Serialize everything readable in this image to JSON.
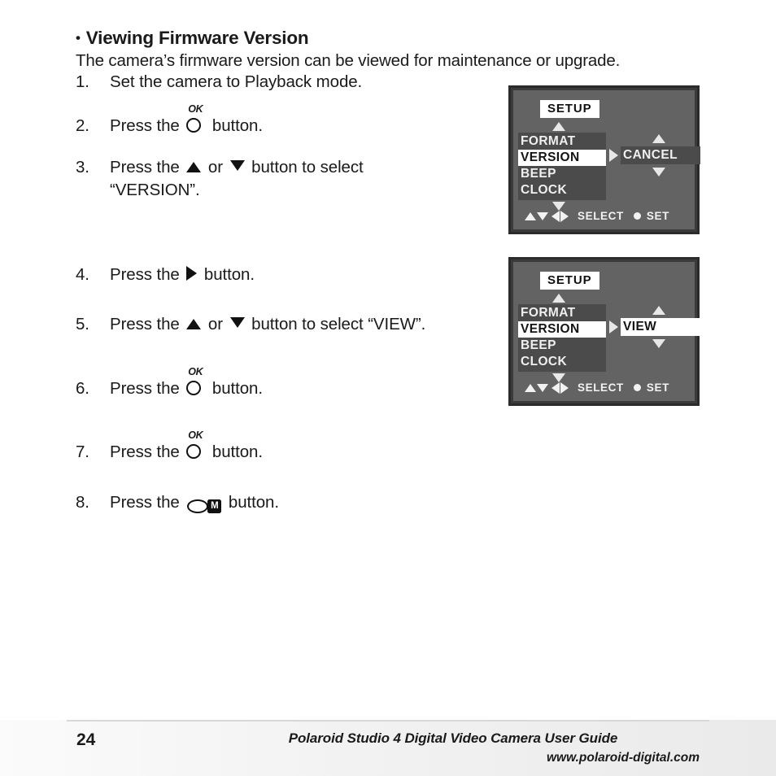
{
  "heading": {
    "bullet": "•",
    "title": "Viewing Firmware Version"
  },
  "intro": "The camera’s firmware version can be viewed for maintenance or upgrade.",
  "steps": [
    {
      "number": "1.",
      "text_before": "Set the camera to Playback mode.",
      "icon": "none",
      "text_after": "",
      "line2": ""
    },
    {
      "number": "2.",
      "text_before": "Press the",
      "icon": "ok-button-icon",
      "icon_label": "OK",
      "text_after": "button.",
      "line2": ""
    },
    {
      "number": "3.",
      "text_before": "Press the",
      "icon": "up-down-arrow-icons",
      "middle_text": "or",
      "text_after": "button to select",
      "line2": "“VERSION”."
    },
    {
      "number": "4.",
      "text_before": "Press the",
      "icon": "right-arrow-icon",
      "text_after": "button.",
      "line2": ""
    },
    {
      "number": "5.",
      "text_before": "Press the",
      "icon": "up-down-arrow-icons",
      "middle_text": "or",
      "text_after": "button to select “VIEW”.",
      "line2": ""
    },
    {
      "number": "6.",
      "text_before": "Press the",
      "icon": "ok-button-icon",
      "icon_label": "OK",
      "text_after": "button.",
      "line2": ""
    },
    {
      "number": "7.",
      "text_before": "Press the",
      "icon": "ok-button-icon",
      "icon_label": "OK",
      "text_after": "button.",
      "line2": ""
    },
    {
      "number": "8.",
      "text_before": "Press the",
      "icon": "mode-button-icon",
      "icon_label": "M",
      "text_after": "button.",
      "line2": ""
    }
  ],
  "lcd_screens": [
    {
      "title": "SETUP",
      "menu_items": [
        {
          "label": "FORMAT",
          "selected": false
        },
        {
          "label": "VERSION",
          "selected": true
        },
        {
          "label": "BEEP",
          "selected": false
        },
        {
          "label": "CLOCK",
          "selected": false
        }
      ],
      "submenu_value": "CANCEL",
      "submenu_highlighted": false,
      "hint_select": "SELECT",
      "hint_set": "SET"
    },
    {
      "title": "SETUP",
      "menu_items": [
        {
          "label": "FORMAT",
          "selected": false
        },
        {
          "label": "VERSION",
          "selected": true
        },
        {
          "label": "BEEP",
          "selected": false
        },
        {
          "label": "CLOCK",
          "selected": false
        }
      ],
      "submenu_value": "VIEW",
      "submenu_highlighted": true,
      "hint_select": "SELECT",
      "hint_set": "SET"
    }
  ],
  "footer": {
    "page_number": "24",
    "title": "Polaroid Studio 4 Digital Video Camera User Guide",
    "url": "www.polaroid-digital.com"
  },
  "colors": {
    "lcd_background": "#636363",
    "lcd_border": "#2b2b2b",
    "lcd_panel": "#4b4b4b",
    "lcd_highlight": "#ffffff",
    "text": "#1a1a1a",
    "footer_band": "#f0f0f0"
  }
}
